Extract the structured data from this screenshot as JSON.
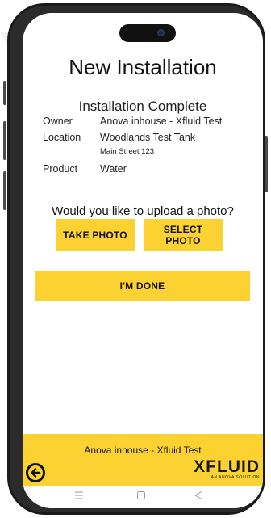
{
  "screen": {
    "title": "New Installation",
    "subtitle": "Installation Complete"
  },
  "details": {
    "owner_label": "Owner",
    "owner_value": "Anova inhouse - Xfluid Test",
    "location_label": "Location",
    "location_value": "Woodlands Test Tank",
    "location_address": "Main Street 123",
    "product_label": "Product",
    "product_value": "Water"
  },
  "photo": {
    "question": "Would you like to upload a photo?",
    "take_photo_label": "TAKE PHOTO",
    "select_photo_label": "SELECT PHOTO"
  },
  "done_label": "I'M DONE",
  "footer": {
    "account_name": "Anova inhouse - Xfluid Test",
    "logo_text": "XFLUID",
    "logo_tagline": "AN ANOVA SOLUTION"
  },
  "icons": {
    "back": "arrow-left-circle-icon",
    "nav_menu": "menu-icon",
    "nav_home": "home-icon",
    "nav_back": "triangle-back-icon"
  },
  "colors": {
    "accent": "#fcd232",
    "text": "#111111",
    "device_frame": "#1a1a1a"
  }
}
